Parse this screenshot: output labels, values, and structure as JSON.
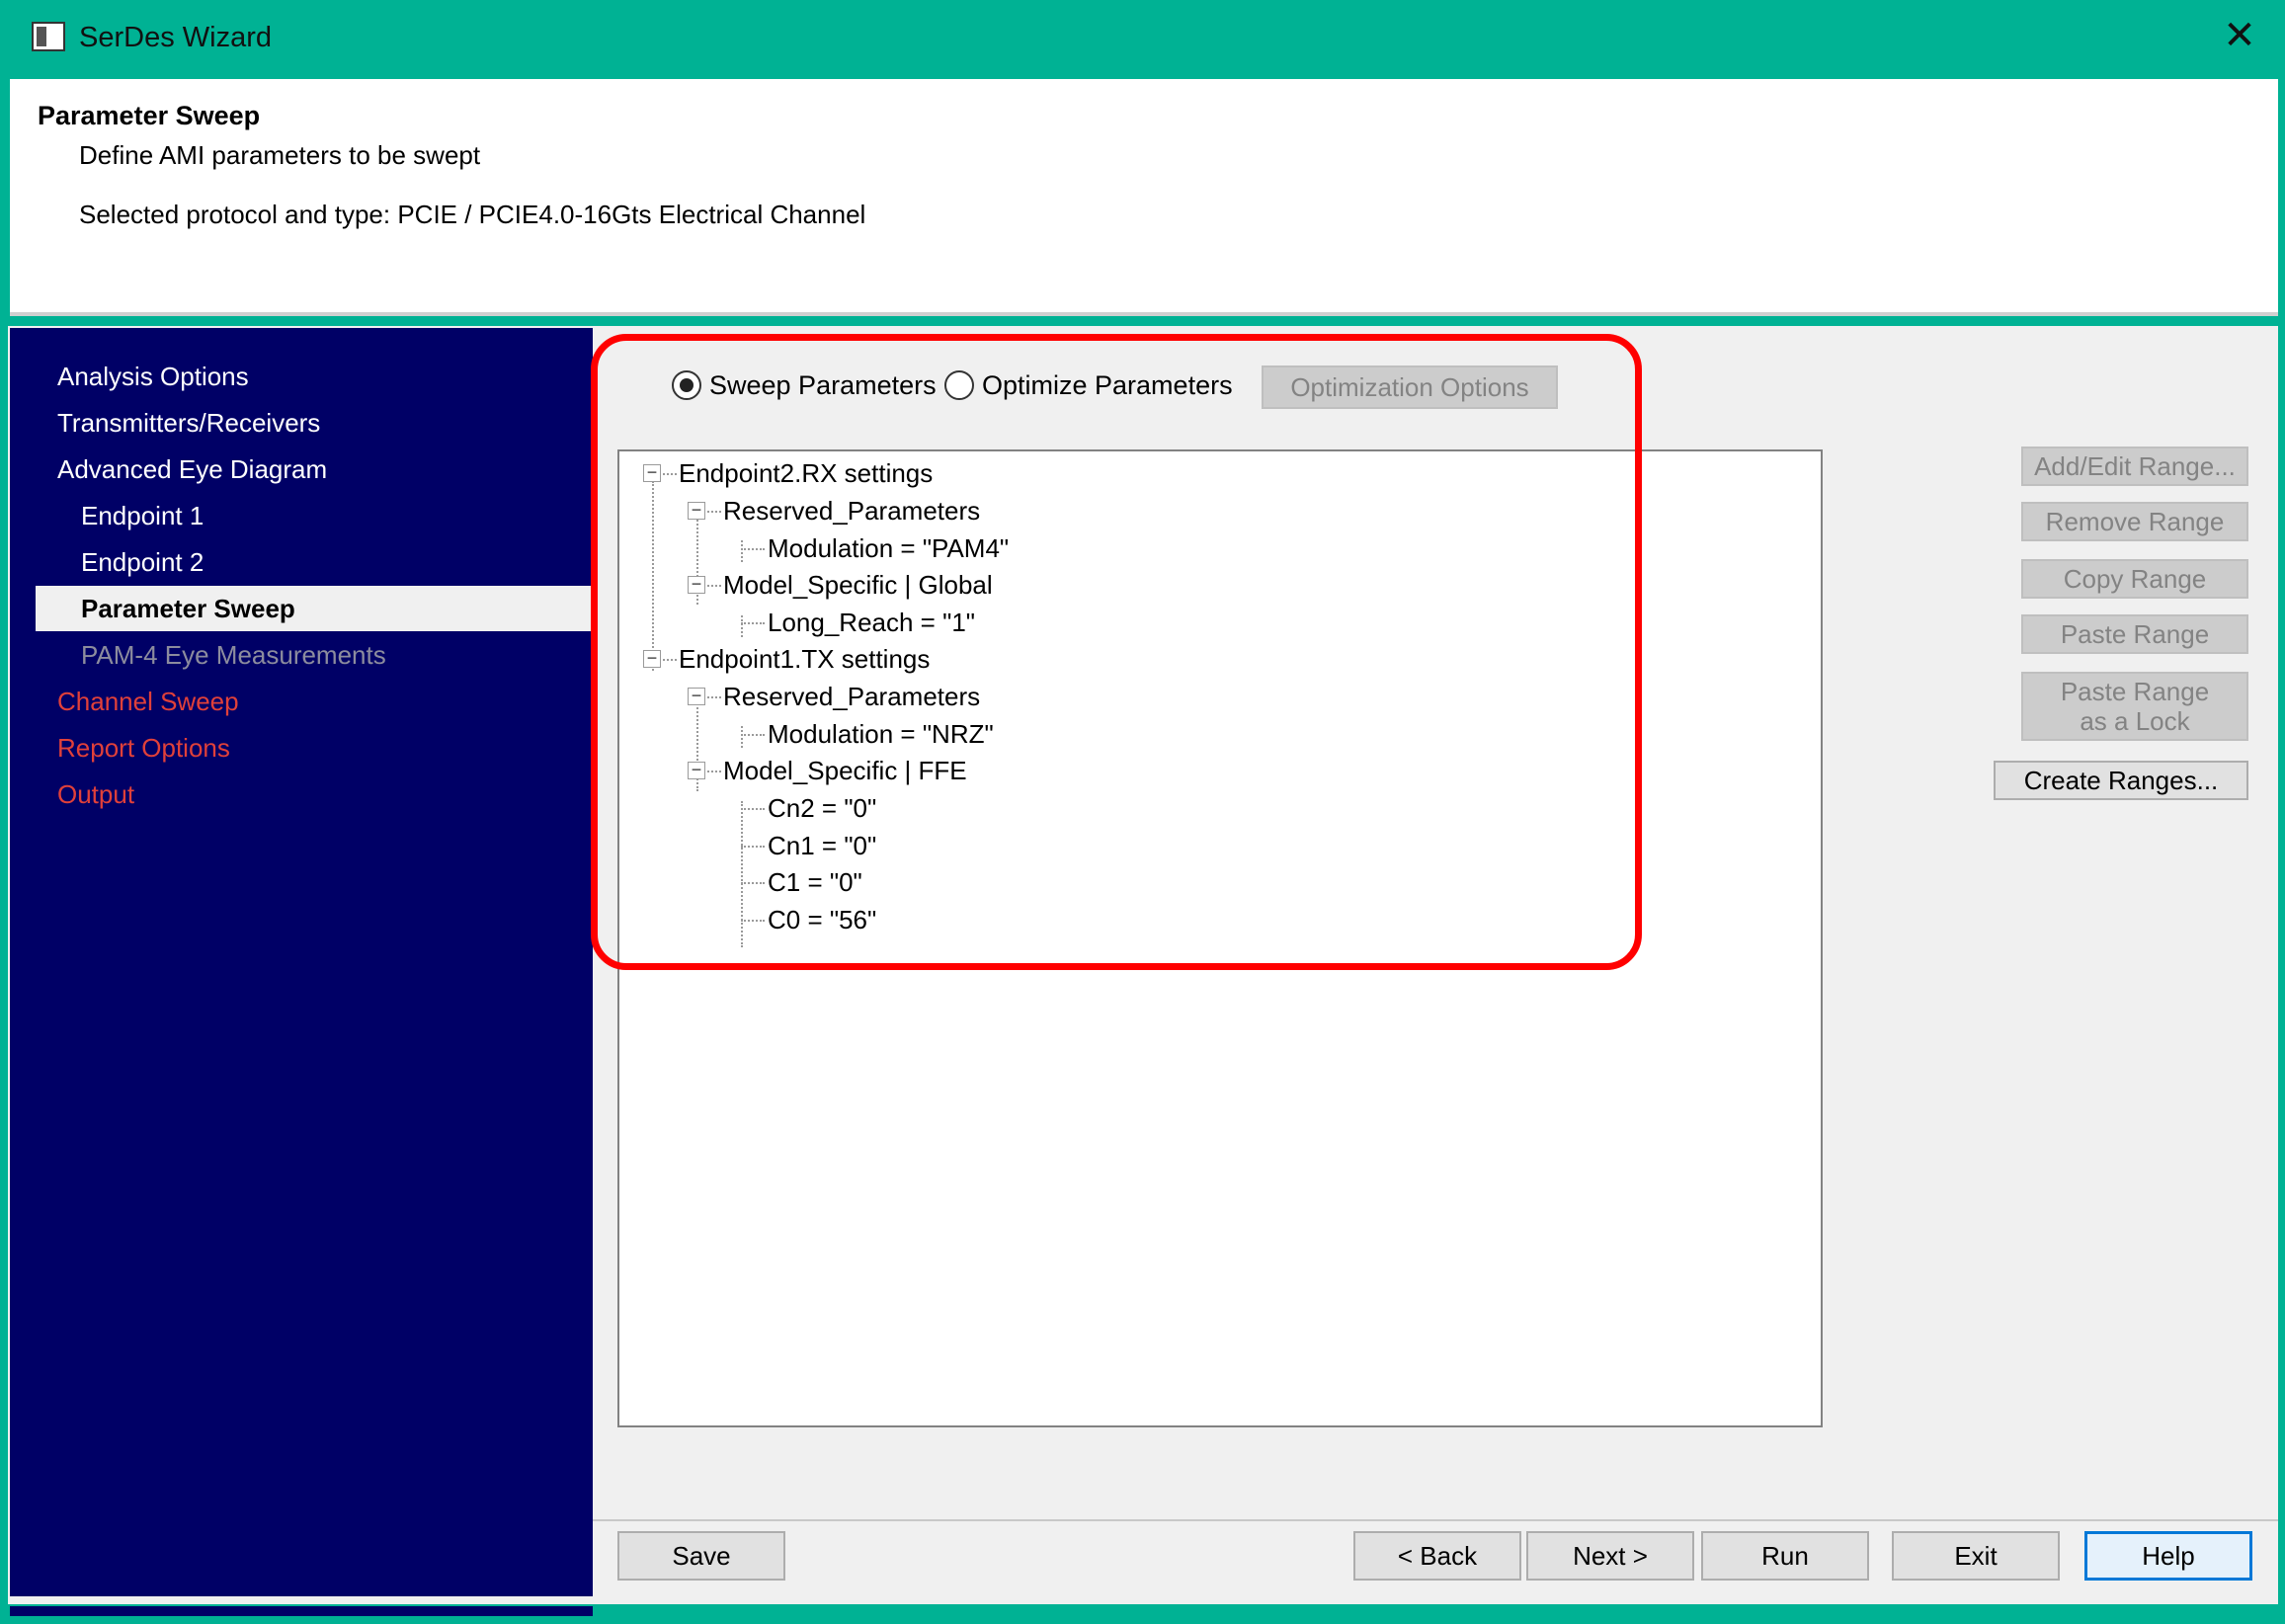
{
  "window": {
    "title": "SerDes Wizard"
  },
  "header": {
    "title": "Parameter Sweep",
    "subtitle": "Define AMI parameters to be swept",
    "protocol": "Selected protocol and type: PCIE / PCIE4.0-16Gts Electrical Channel"
  },
  "sidebar": {
    "items": [
      {
        "label": "Analysis Options"
      },
      {
        "label": "Transmitters/Receivers"
      },
      {
        "label": "Advanced Eye Diagram"
      },
      {
        "label": "Endpoint 1"
      },
      {
        "label": "Endpoint 2"
      },
      {
        "label": "Parameter Sweep"
      },
      {
        "label": "PAM-4 Eye Measurements"
      },
      {
        "label": "Channel Sweep"
      },
      {
        "label": "Report Options"
      },
      {
        "label": "Output"
      }
    ]
  },
  "mode": {
    "sweep_label": "Sweep Parameters",
    "optimize_label": "Optimize Parameters",
    "selected": "Sweep Parameters",
    "optimization_options_label": "Optimization Options"
  },
  "tree": {
    "nodes": [
      {
        "label": "Endpoint2.RX settings"
      },
      {
        "label": "Reserved_Parameters"
      },
      {
        "label": "Modulation = \"PAM4\""
      },
      {
        "label": "Model_Specific | Global"
      },
      {
        "label": "Long_Reach = \"1\""
      },
      {
        "label": "Endpoint1.TX settings"
      },
      {
        "label": "Reserved_Parameters"
      },
      {
        "label": "Modulation = \"NRZ\""
      },
      {
        "label": "Model_Specific | FFE"
      },
      {
        "label": "Cn2 = \"0\""
      },
      {
        "label": "Cn1 = \"0\""
      },
      {
        "label": "C1 = \"0\""
      },
      {
        "label": "C0 = \"56\""
      }
    ]
  },
  "range_buttons": {
    "add_edit": "Add/Edit Range...",
    "remove": "Remove Range",
    "copy": "Copy Range",
    "paste": "Paste Range",
    "paste_lock_line1": "Paste Range",
    "paste_lock_line2": "as a Lock",
    "create": "Create Ranges..."
  },
  "footer": {
    "save": "Save",
    "back": "< Back",
    "next": "Next >",
    "run": "Run",
    "exit": "Exit",
    "help": "Help"
  },
  "icons": [
    "app-icon",
    "close-icon",
    "minus-expander-icon"
  ],
  "colors": {
    "titlebar": "#00b294",
    "sidebar": "#000066",
    "highlight": "#ff0000",
    "nav_red": "#e0403a"
  }
}
